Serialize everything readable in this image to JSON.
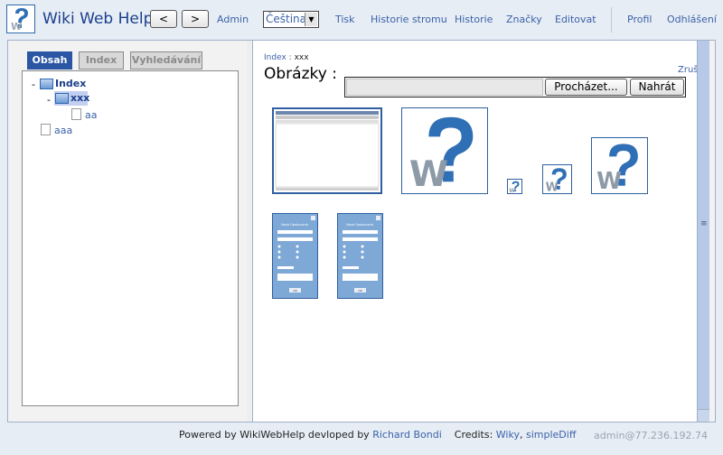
{
  "header": {
    "app_title": "Wiki Web Help",
    "back_label": "<",
    "forward_label": ">",
    "admin_label": "Admin",
    "language_value": "Čeština",
    "print_label": "Tisk",
    "tree_history_label": "Historie stromu",
    "history_label": "Historie",
    "tags_label": "Značky",
    "edit_label": "Editovat",
    "profile_label": "Profil",
    "logout_label": "Odhlášení"
  },
  "sidebar": {
    "tabs": [
      {
        "label": "Obsah",
        "active": true
      },
      {
        "label": "Index",
        "active": false
      },
      {
        "label": "Vyhledávání",
        "active": false
      }
    ],
    "tree": {
      "root_label": "Index",
      "child_label": "xxx",
      "leaf_label": "aa",
      "sibling_label": "aaa",
      "expand_symbol": "-"
    }
  },
  "main": {
    "breadcrumb_link": "Index",
    "breadcrumb_sep": ":",
    "breadcrumb_current": "xxx",
    "page_title": "Obrázky :",
    "cancel_label": "Zrušit",
    "browse_label": "Procházet...",
    "upload_label": "Nahrát",
    "dialog_title": "Nová Opakovaná",
    "ok_label": "OK"
  },
  "footer": {
    "powered_text": "Powered by WikiWebHelp devloped by",
    "author_link": "Richard Bondi",
    "credits_label": "Credits:",
    "credit_1": "Wiky",
    "credit_sep": ",",
    "credit_2": "simpleDiff",
    "user_info": "admin@77.236.192.74"
  },
  "colors": {
    "accent": "#2a56a4",
    "link": "#3c62a8",
    "background": "#e6edf5",
    "logo_blue": "#2f6fb5"
  },
  "icons": [
    "wiki-help-logo-icon",
    "folder-icon",
    "document-icon",
    "question-mark-icon",
    "select-arrow-icon"
  ]
}
